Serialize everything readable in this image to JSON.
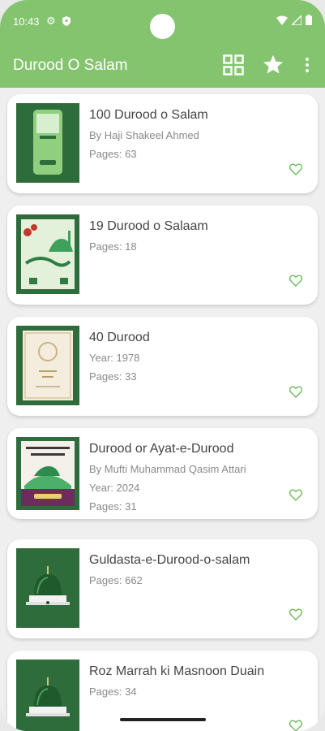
{
  "status_bar": {
    "time": "10:43"
  },
  "app_bar": {
    "title": "Durood O Salam"
  },
  "books": [
    {
      "title": "100 Durood o Salam",
      "lines": [
        "By Haji Shakeel Ahmed",
        "Pages: 63"
      ],
      "cover": "cover-100"
    },
    {
      "title": "19 Durood o Salaam",
      "lines": [
        "Pages: 18"
      ],
      "cover": "cover-19"
    },
    {
      "title": "40 Durood",
      "lines": [
        "Year: 1978",
        "Pages: 33"
      ],
      "cover": "cover-40"
    },
    {
      "title": "Durood or Ayat-e-Durood",
      "lines": [
        "By Mufti Muhammad Qasim Attari",
        "Year: 2024",
        "Pages: 31"
      ],
      "cover": "cover-ayat"
    },
    {
      "title": "Guldasta-e-Durood-o-salam",
      "lines": [
        "Pages: 662"
      ],
      "cover": "cover-dome"
    },
    {
      "title": "Roz Marrah ki Masnoon Duain",
      "lines": [
        "Pages: 34"
      ],
      "cover": "cover-dome"
    }
  ],
  "colors": {
    "accent": "#84c46f",
    "heart": "#6cbb5a",
    "cover_bg": "#2d6a3a"
  }
}
